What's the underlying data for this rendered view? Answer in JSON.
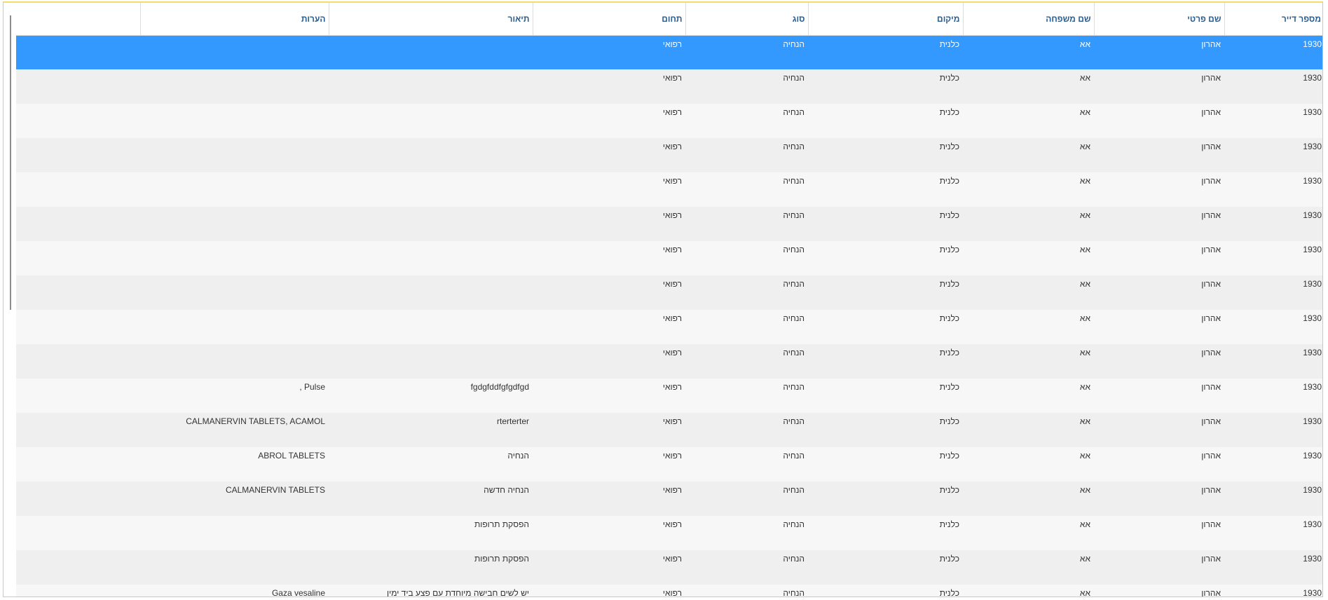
{
  "grid": {
    "columns": [
      {
        "key": "resident_no",
        "label": "מספר דייר"
      },
      {
        "key": "first_name",
        "label": "שם פרטי"
      },
      {
        "key": "last_name",
        "label": "שם משפחה"
      },
      {
        "key": "location",
        "label": "מיקום"
      },
      {
        "key": "type",
        "label": "סוג"
      },
      {
        "key": "domain",
        "label": "תחום"
      },
      {
        "key": "description",
        "label": "תיאור"
      },
      {
        "key": "notes",
        "label": "הערות"
      },
      {
        "key": "extra",
        "label": ""
      }
    ],
    "selected_row": 0,
    "rows": [
      {
        "resident_no": "1930",
        "first_name": "אהרון",
        "last_name": "אא",
        "location": "כלנית",
        "type": "הנחיה",
        "domain": "רפואי",
        "description": "",
        "notes": ""
      },
      {
        "resident_no": "1930",
        "first_name": "אהרון",
        "last_name": "אא",
        "location": "כלנית",
        "type": "הנחיה",
        "domain": "רפואי",
        "description": "",
        "notes": ""
      },
      {
        "resident_no": "1930",
        "first_name": "אהרון",
        "last_name": "אא",
        "location": "כלנית",
        "type": "הנחיה",
        "domain": "רפואי",
        "description": "",
        "notes": ""
      },
      {
        "resident_no": "1930",
        "first_name": "אהרון",
        "last_name": "אא",
        "location": "כלנית",
        "type": "הנחיה",
        "domain": "רפואי",
        "description": "",
        "notes": ""
      },
      {
        "resident_no": "1930",
        "first_name": "אהרון",
        "last_name": "אא",
        "location": "כלנית",
        "type": "הנחיה",
        "domain": "רפואי",
        "description": "",
        "notes": ""
      },
      {
        "resident_no": "1930",
        "first_name": "אהרון",
        "last_name": "אא",
        "location": "כלנית",
        "type": "הנחיה",
        "domain": "רפואי",
        "description": "",
        "notes": ""
      },
      {
        "resident_no": "1930",
        "first_name": "אהרון",
        "last_name": "אא",
        "location": "כלנית",
        "type": "הנחיה",
        "domain": "רפואי",
        "description": "",
        "notes": ""
      },
      {
        "resident_no": "1930",
        "first_name": "אהרון",
        "last_name": "אא",
        "location": "כלנית",
        "type": "הנחיה",
        "domain": "רפואי",
        "description": "",
        "notes": ""
      },
      {
        "resident_no": "1930",
        "first_name": "אהרון",
        "last_name": "אא",
        "location": "כלנית",
        "type": "הנחיה",
        "domain": "רפואי",
        "description": "",
        "notes": ""
      },
      {
        "resident_no": "1930",
        "first_name": "אהרון",
        "last_name": "אא",
        "location": "כלנית",
        "type": "הנחיה",
        "domain": "רפואי",
        "description": "",
        "notes": ""
      },
      {
        "resident_no": "1930",
        "first_name": "אהרון",
        "last_name": "אא",
        "location": "כלנית",
        "type": "הנחיה",
        "domain": "רפואי",
        "description": "fgdgfddfgfgdfgd",
        "notes": ", Pulse"
      },
      {
        "resident_no": "1930",
        "first_name": "אהרון",
        "last_name": "אא",
        "location": "כלנית",
        "type": "הנחיה",
        "domain": "רפואי",
        "description": "rterterter",
        "notes": "CALMANERVIN TABLETS, ACAMOL"
      },
      {
        "resident_no": "1930",
        "first_name": "אהרון",
        "last_name": "אא",
        "location": "כלנית",
        "type": "הנחיה",
        "domain": "רפואי",
        "description": "הנחיה",
        "notes": "ABROL TABLETS"
      },
      {
        "resident_no": "1930",
        "first_name": "אהרון",
        "last_name": "אא",
        "location": "כלנית",
        "type": "הנחיה",
        "domain": "רפואי",
        "description": "הנחיה חדשה",
        "notes": "CALMANERVIN TABLETS"
      },
      {
        "resident_no": "1930",
        "first_name": "אהרון",
        "last_name": "אא",
        "location": "כלנית",
        "type": "הנחיה",
        "domain": "רפואי",
        "description": "הפסקת תרופות",
        "notes": ""
      },
      {
        "resident_no": "1930",
        "first_name": "אהרון",
        "last_name": "אא",
        "location": "כלנית",
        "type": "הנחיה",
        "domain": "רפואי",
        "description": "הפסקת תרופות",
        "notes": ""
      },
      {
        "resident_no": "1930",
        "first_name": "אהרון",
        "last_name": "אא",
        "location": "כלנית",
        "type": "הנחיה",
        "domain": "רפואי",
        "description": "יש לשים חבישה מיוחדת עם פצע ביד ימין",
        "notes": "Gaza vesaline"
      }
    ]
  },
  "colors": {
    "header_text": "#2b5d8f",
    "selection": "#3399ff",
    "row_odd": "#f7f7f7",
    "row_even": "#efefef"
  }
}
